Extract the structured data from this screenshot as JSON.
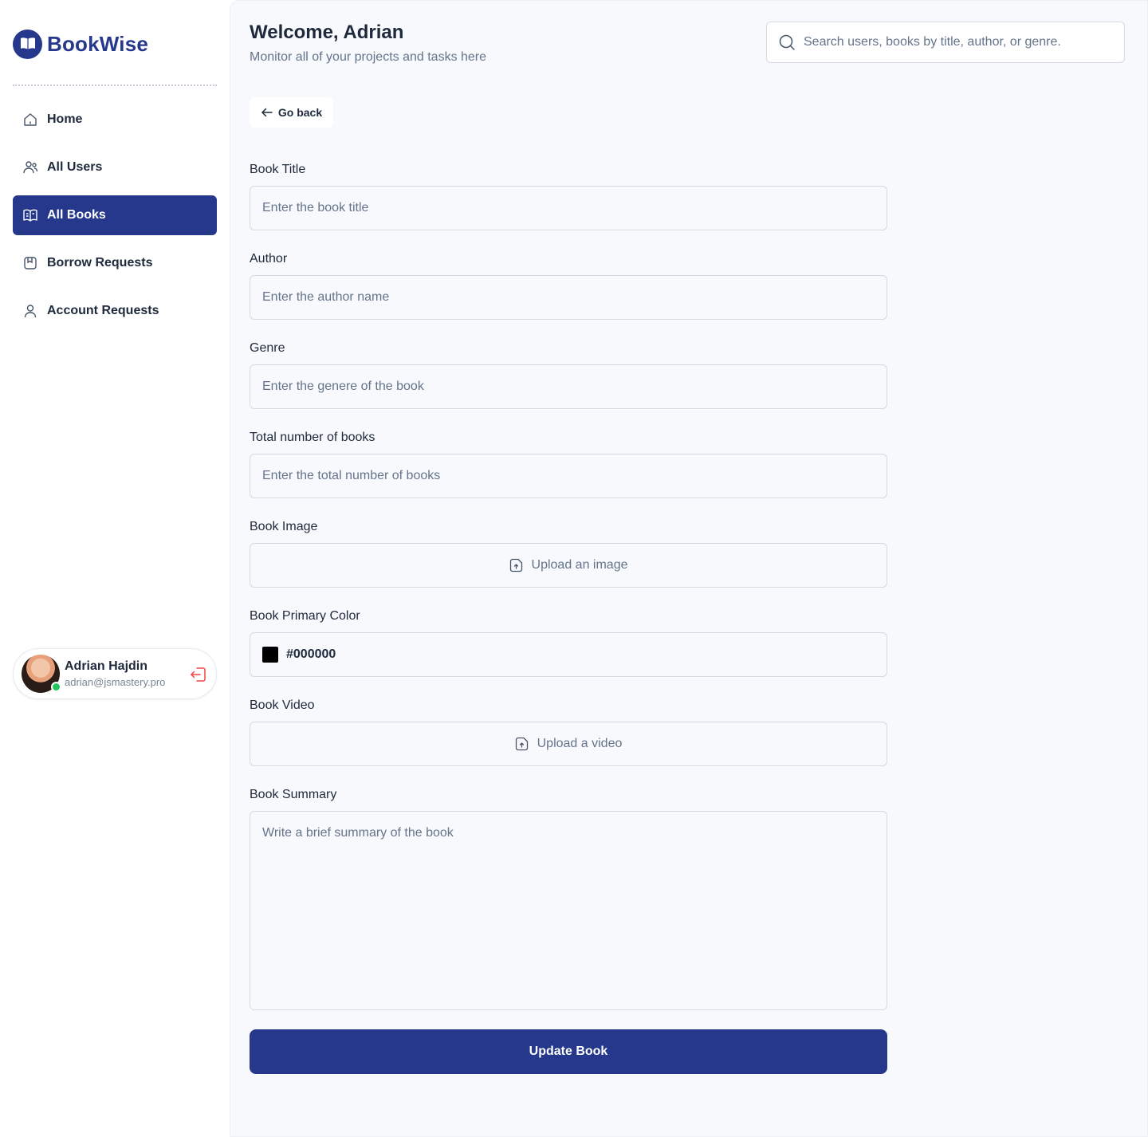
{
  "brand": {
    "name": "BookWise",
    "color": "#25388c"
  },
  "sidebar": {
    "items": [
      {
        "label": "Home",
        "icon": "home-icon"
      },
      {
        "label": "All Users",
        "icon": "users-icon"
      },
      {
        "label": "All Books",
        "icon": "book-open-icon",
        "active": true
      },
      {
        "label": "Borrow Requests",
        "icon": "bookmark-icon"
      },
      {
        "label": "Account Requests",
        "icon": "user-icon"
      }
    ]
  },
  "user": {
    "name": "Adrian Hajdin",
    "email": "adrian@jsmastery.pro",
    "status": "online"
  },
  "header": {
    "title": "Welcome, Adrian",
    "subtitle": "Monitor all of your projects and tasks here",
    "search_placeholder": "Search users, books by title, author, or genre."
  },
  "actions": {
    "go_back": "Go back",
    "submit": "Update Book"
  },
  "form": {
    "title": {
      "label": "Book Title",
      "placeholder": "Enter the book title"
    },
    "author": {
      "label": "Author",
      "placeholder": "Enter the author name"
    },
    "genre": {
      "label": "Genre",
      "placeholder": "Enter the genere of the book"
    },
    "total": {
      "label": "Total number of books",
      "placeholder": "Enter the total number of books"
    },
    "image": {
      "label": "Book Image",
      "button": "Upload an image"
    },
    "color": {
      "label": "Book Primary Color",
      "value": "#000000"
    },
    "video": {
      "label": "Book Video",
      "button": "Upload a video"
    },
    "summary": {
      "label": "Book Summary",
      "placeholder": "Write a brief summary of the book"
    }
  },
  "colors": {
    "accent": "#25388c",
    "online": "#22c55e",
    "logout": "#ef4444"
  }
}
